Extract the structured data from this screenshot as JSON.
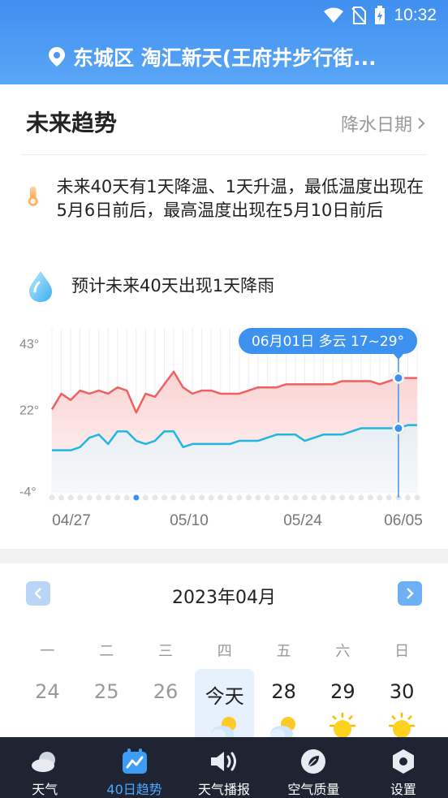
{
  "status": {
    "time": "10:32"
  },
  "header": {
    "location": "东城区 淘汇新天(王府井步行街..."
  },
  "trend": {
    "title": "未来趋势",
    "link": "降水日期",
    "summary_temp": "未来40天有1天降温、1天升温，最低温度出现在5月6日前后，最高温度出现在5月10日前后",
    "summary_rain": "预计未来40天出现1天降雨"
  },
  "chart_data": {
    "type": "line",
    "y_ticks": [
      "43°",
      "22°",
      "-4°"
    ],
    "ylim": [
      -4,
      43
    ],
    "x_ticks": [
      "04/27",
      "05/10",
      "05/24",
      "06/05"
    ],
    "tooltip": "06月01日 多云 17~29°",
    "series": [
      {
        "values": [
          22,
          27,
          25,
          28,
          27,
          28,
          27,
          29,
          28,
          21,
          27,
          26,
          30,
          34,
          29,
          27,
          28,
          28,
          27,
          27,
          27,
          28,
          29,
          29,
          29,
          30,
          30,
          30,
          30,
          30,
          30,
          31,
          31,
          31,
          31,
          30,
          31,
          32,
          32,
          32
        ]
      },
      {
        "values": [
          9,
          9,
          9,
          10,
          13,
          14,
          11,
          15,
          15,
          12,
          11,
          12,
          15,
          15,
          10,
          11,
          11,
          11,
          11,
          11,
          12,
          12,
          12,
          13,
          14,
          14,
          14,
          12,
          13,
          14,
          14,
          14,
          15,
          16,
          16,
          16,
          16,
          16,
          17,
          17
        ]
      }
    ],
    "highlight_index": 37,
    "colors": {
      "high": "#f06060",
      "low": "#1fb6e0",
      "accent": "#3d92ef"
    }
  },
  "calendar": {
    "month": "2023年04月",
    "weekdays": [
      "一",
      "二",
      "三",
      "四",
      "五",
      "六",
      "日"
    ],
    "days": [
      {
        "label": "24",
        "state": "past"
      },
      {
        "label": "25",
        "state": "past"
      },
      {
        "label": "26",
        "state": "past"
      },
      {
        "label": "今天",
        "state": "today",
        "icon": "partly-cloudy-icon"
      },
      {
        "label": "28",
        "state": "cur",
        "icon": "partly-cloudy-icon"
      },
      {
        "label": "29",
        "state": "cur",
        "icon": "sunny-icon"
      },
      {
        "label": "30",
        "state": "cur",
        "icon": "sunny-icon"
      }
    ]
  },
  "tabbar": {
    "tabs": [
      {
        "label": "天气",
        "icon": "cloud-icon"
      },
      {
        "label": "40日趋势",
        "icon": "trend-calendar-icon",
        "active": true
      },
      {
        "label": "天气播报",
        "icon": "speaker-icon"
      },
      {
        "label": "空气质量",
        "icon": "leaf-icon"
      },
      {
        "label": "设置",
        "icon": "hexagon-settings-icon"
      }
    ]
  }
}
